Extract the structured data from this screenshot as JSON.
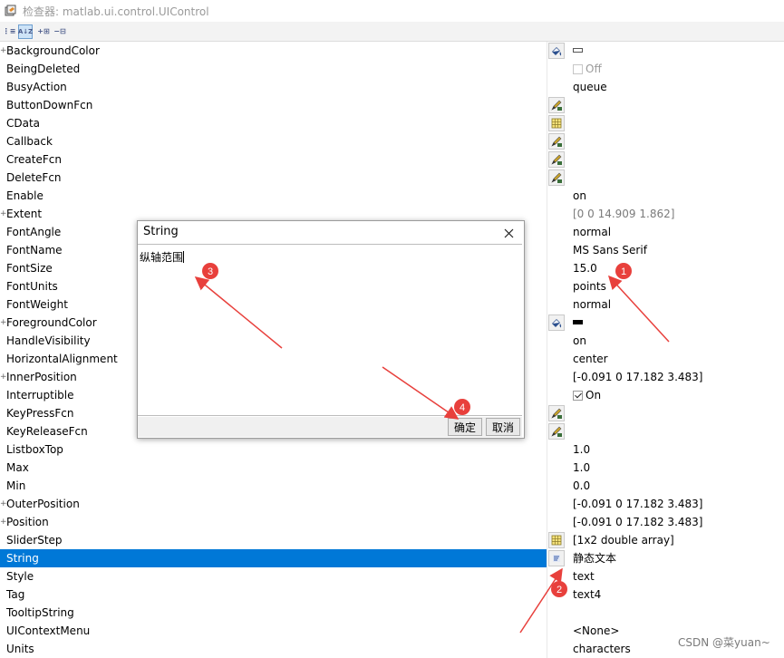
{
  "window": {
    "title": "检查器:  matlab.ui.control.UIControl"
  },
  "toolbar": {
    "sort_category": "⋮≡",
    "sort_alpha": "A↓Z",
    "expand": "+⊞",
    "collapse": "−⊟"
  },
  "properties": [
    {
      "name": "BackgroundColor",
      "expandable": true,
      "button": "color",
      "value_type": "swatch",
      "swatch_style": "empty"
    },
    {
      "name": "BeingDeleted",
      "value_type": "checkbox",
      "checked": false,
      "value": "Off"
    },
    {
      "name": "BusyAction",
      "value": "queue"
    },
    {
      "name": "ButtonDownFcn",
      "button": "edit"
    },
    {
      "name": "CData",
      "button": "grid"
    },
    {
      "name": "Callback",
      "button": "edit"
    },
    {
      "name": "CreateFcn",
      "button": "edit"
    },
    {
      "name": "DeleteFcn",
      "button": "edit"
    },
    {
      "name": "Enable",
      "value": "on"
    },
    {
      "name": "Extent",
      "expandable": true,
      "value": "[0 0 14.909 1.862]",
      "gray": true
    },
    {
      "name": "FontAngle",
      "value": "normal"
    },
    {
      "name": "FontName",
      "value": "MS Sans Serif"
    },
    {
      "name": "FontSize",
      "value": "15.0"
    },
    {
      "name": "FontUnits",
      "value": "points"
    },
    {
      "name": "FontWeight",
      "value": "normal"
    },
    {
      "name": "ForegroundColor",
      "expandable": true,
      "button": "color",
      "value_type": "swatch",
      "swatch_style": "black"
    },
    {
      "name": "HandleVisibility",
      "value": "on"
    },
    {
      "name": "HorizontalAlignment",
      "value": "center"
    },
    {
      "name": "InnerPosition",
      "expandable": true,
      "value": "[-0.091 0 17.182 3.483]"
    },
    {
      "name": "Interruptible",
      "value_type": "checkbox",
      "checked": true,
      "value": "On"
    },
    {
      "name": "KeyPressFcn",
      "button": "edit"
    },
    {
      "name": "KeyReleaseFcn",
      "button": "edit"
    },
    {
      "name": "ListboxTop",
      "value": "1.0"
    },
    {
      "name": "Max",
      "value": "1.0"
    },
    {
      "name": "Min",
      "value": "0.0"
    },
    {
      "name": "OuterPosition",
      "expandable": true,
      "value": "[-0.091 0 17.182 3.483]"
    },
    {
      "name": "Position",
      "expandable": true,
      "value": "[-0.091 0 17.182 3.483]"
    },
    {
      "name": "SliderStep",
      "button": "grid",
      "value": "[1x2  double array]"
    },
    {
      "name": "String",
      "button": "text",
      "value": "静态文本",
      "selected": true
    },
    {
      "name": "Style",
      "value": "text"
    },
    {
      "name": "Tag",
      "value": "text4"
    },
    {
      "name": "TooltipString"
    },
    {
      "name": "UIContextMenu",
      "value": "<None>"
    },
    {
      "name": "Units",
      "value": "characters"
    }
  ],
  "dialog": {
    "title": "String",
    "text": "纵轴范围",
    "ok_label": "确定",
    "cancel_label": "取消"
  },
  "annotations": {
    "labels": [
      "1",
      "2",
      "3",
      "4"
    ],
    "color": "#e8403c"
  },
  "watermark": "CSDN @菜yuan~"
}
